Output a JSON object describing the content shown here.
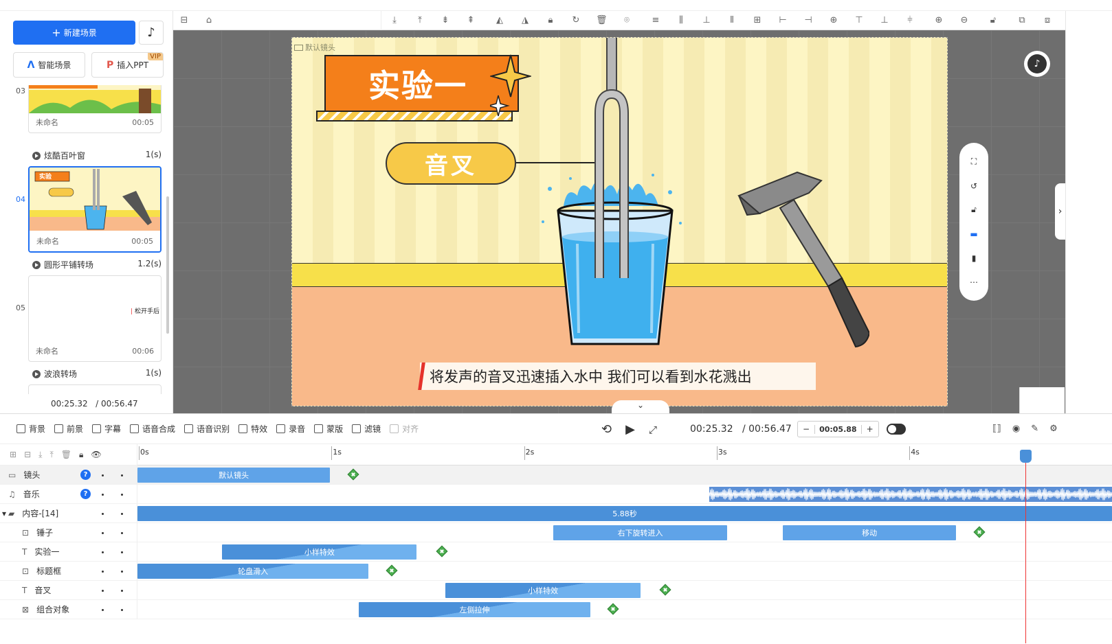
{
  "sidebar": {
    "new_scene_label": "新建场景",
    "smart_scene_label": "智能场景",
    "insert_ppt_label": "插入PPT",
    "vip_badge": "VIP",
    "time_current": "00:25.32",
    "time_total": "/ 00:56.47",
    "scenes": [
      {
        "num": "03",
        "name": "未命名",
        "duration": "00:05",
        "transition": "炫酷百叶窗",
        "trans_dur": "1(s)"
      },
      {
        "num": "04",
        "name": "未命名",
        "duration": "00:05",
        "transition": "圆形平铺转场",
        "trans_dur": "1.2(s)",
        "thumb_title": "实验一",
        "thumb_pill": "音叉"
      },
      {
        "num": "05",
        "name": "未命名",
        "duration": "00:06",
        "transition": "波浪转场",
        "trans_dur": "1(s)",
        "thumb_text": "松开手后"
      }
    ]
  },
  "canvas": {
    "camera_tag": "默认镜头",
    "banner_text": "实验一",
    "pill_text": "音叉",
    "subtitle": "将发声的音叉迅速插入水中 我们可以看到水花溅出"
  },
  "timeline": {
    "toolbar": [
      {
        "label": "背景",
        "icon": "background-icon",
        "disabled": false
      },
      {
        "label": "前景",
        "icon": "foreground-icon",
        "disabled": false
      },
      {
        "label": "字幕",
        "icon": "subtitle-icon",
        "disabled": false
      },
      {
        "label": "语音合成",
        "icon": "tts-icon",
        "disabled": false
      },
      {
        "label": "语音识别",
        "icon": "asr-icon",
        "disabled": false
      },
      {
        "label": "特效",
        "icon": "effects-icon",
        "disabled": false
      },
      {
        "label": "录音",
        "icon": "microphone-icon",
        "disabled": false
      },
      {
        "label": "蒙版",
        "icon": "mask-icon",
        "disabled": false
      },
      {
        "label": "滤镜",
        "icon": "filter-icon",
        "disabled": false
      },
      {
        "label": "对齐",
        "icon": "align-icon",
        "disabled": true
      }
    ],
    "time_current": "00:25.32",
    "time_total": "/ 00:56.47",
    "zoom_value": "00:05.88",
    "zoom_minus": "−",
    "zoom_plus": "+",
    "ruler": [
      "0s",
      "1s",
      "2s",
      "3s",
      "4s"
    ],
    "tracks": [
      {
        "name": "镜头",
        "help": true,
        "clips": [
          {
            "label": "默认镜头",
            "start": 0,
            "end": 1.0,
            "style": "flat"
          }
        ],
        "keyframe": 1.12
      },
      {
        "name": "音乐",
        "help": true,
        "clips": [],
        "waveform": {
          "start": 2.97,
          "end": 5.88
        }
      },
      {
        "name": "内容-[14]",
        "folder": true,
        "clips": [
          {
            "label": "5.88秒",
            "start": 0,
            "end": 5.88,
            "style": "flat"
          }
        ]
      },
      {
        "name": "锤子",
        "clips": [
          {
            "label": "右下旋转进入",
            "start": 2.16,
            "end": 3.06,
            "style": "flat"
          },
          {
            "label": "移动",
            "start": 3.35,
            "end": 4.25,
            "style": "flat"
          }
        ],
        "keyframe": 4.37
      },
      {
        "name": "实验一",
        "clips": [
          {
            "label": "小样特效",
            "start": 0.44,
            "end": 1.45,
            "style": "tri"
          }
        ],
        "keyframe": 1.58
      },
      {
        "name": "标题框",
        "clips": [
          {
            "label": "轮盘滑入",
            "start": 0,
            "end": 1.2,
            "style": "tri"
          }
        ],
        "keyframe": 1.32
      },
      {
        "name": "音叉",
        "clips": [
          {
            "label": "小样特效",
            "start": 1.6,
            "end": 2.61,
            "style": "tri"
          }
        ],
        "keyframe": 2.74
      },
      {
        "name": "组合对象",
        "clips": [
          {
            "label": "左侧拉伸",
            "start": 1.15,
            "end": 2.35,
            "style": "tri"
          }
        ],
        "keyframe": 2.47
      }
    ],
    "playhead_time": 4.6
  }
}
